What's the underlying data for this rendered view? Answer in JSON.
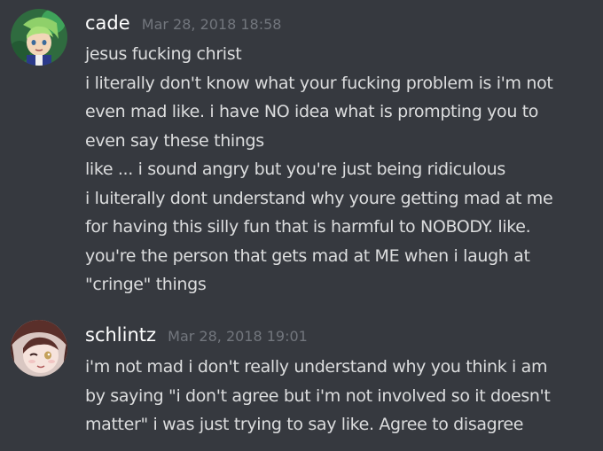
{
  "messages": [
    {
      "username": "cade",
      "timestamp": "Mar 28, 2018 18:58",
      "avatar_icon": "green-haired-character-avatar-icon",
      "lines": [
        "jesus fucking christ",
        "i literally don't know what your fucking problem is i'm not",
        "even mad like. i have NO idea what is prompting you to",
        "even say these things",
        "like ... i sound angry but you're just being ridiculous",
        "i luiterally dont understand why youre getting mad at me",
        "for having this silly fun that is harmful to NOBODY. like.",
        "you're the person that gets mad at ME when i laugh at",
        "\"cringe\" things"
      ]
    },
    {
      "username": "schlintz",
      "timestamp": "Mar 28, 2018 19:01",
      "avatar_icon": "winking-character-avatar-icon",
      "lines": [
        "i'm not mad i don't really understand why you think i am",
        "by saying \"i don't agree but i'm not involved so it doesn't",
        "matter\" i was just trying to say like. Agree to disagree"
      ]
    }
  ]
}
